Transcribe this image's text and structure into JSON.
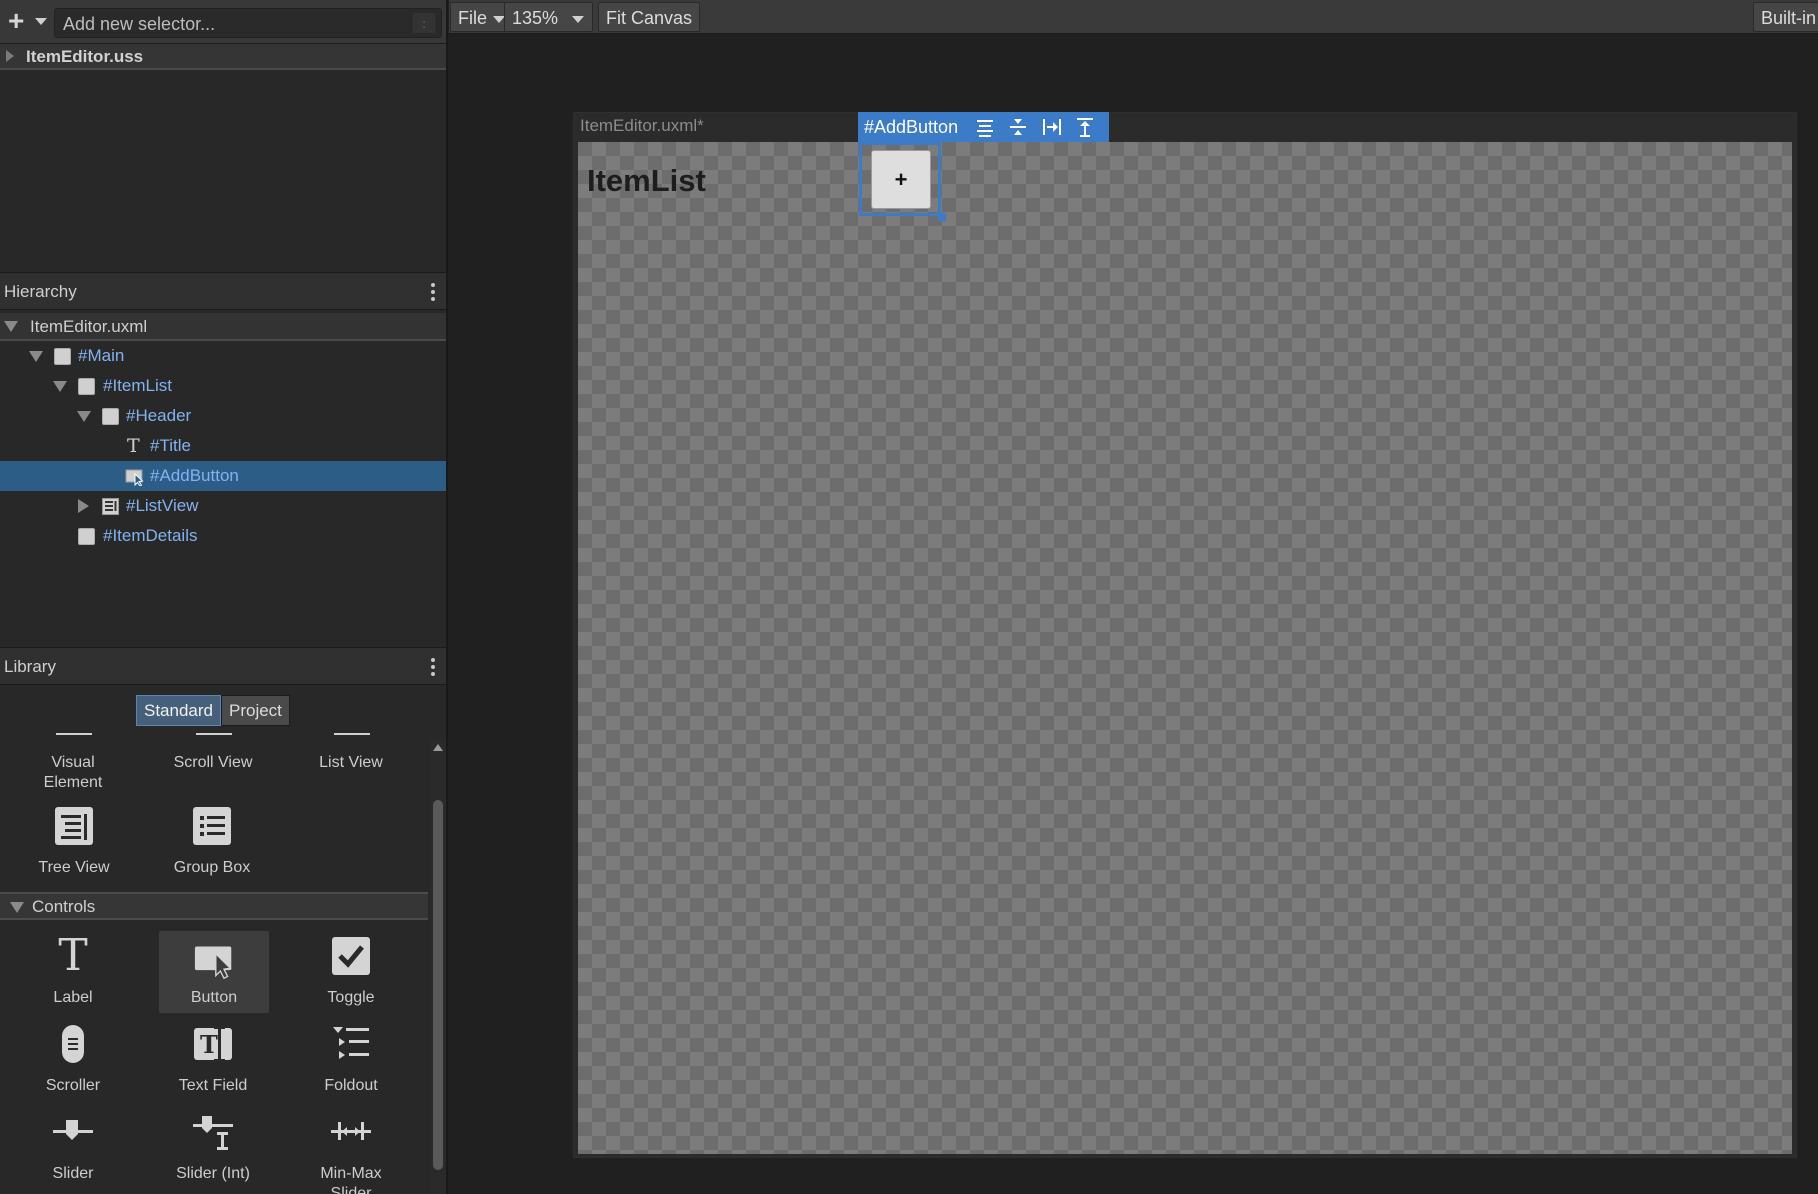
{
  "selectors": {
    "add_label": "+",
    "input_value": "Add new selector...",
    "menu_dots": ":"
  },
  "stylesheets": [
    {
      "label": "ItemEditor.uss"
    }
  ],
  "hierarchy": {
    "title": "Hierarchy",
    "root": "ItemEditor.uxml",
    "items": [
      {
        "label": "#Main",
        "icon": "visual-element-icon",
        "expanded": true
      },
      {
        "label": "#ItemList",
        "icon": "visual-element-icon",
        "expanded": true
      },
      {
        "label": "#Header",
        "icon": "visual-element-icon",
        "expanded": true
      },
      {
        "label": "#Title",
        "icon": "label-icon"
      },
      {
        "label": "#AddButton",
        "icon": "button-icon",
        "selected": true
      },
      {
        "label": "#ListView",
        "icon": "list-view-icon",
        "expanded": false
      },
      {
        "label": "#ItemDetails",
        "icon": "visual-element-icon"
      }
    ]
  },
  "library": {
    "title": "Library",
    "tabs": [
      "Standard",
      "Project"
    ],
    "active_tab": "Standard",
    "containers": [
      {
        "label": "Visual\nElement",
        "icon": "visual-element-icon"
      },
      {
        "label": "Scroll View",
        "icon": "scroll-view-icon"
      },
      {
        "label": "List View",
        "icon": "list-view-icon"
      },
      {
        "label": "Tree View",
        "icon": "tree-view-icon"
      },
      {
        "label": "Group Box",
        "icon": "group-box-icon"
      }
    ],
    "controls_section": "Controls",
    "controls": [
      {
        "label": "Label",
        "icon": "label-icon"
      },
      {
        "label": "Button",
        "icon": "button-icon"
      },
      {
        "label": "Toggle",
        "icon": "toggle-icon"
      },
      {
        "label": "Scroller",
        "icon": "scroller-icon"
      },
      {
        "label": "Text Field",
        "icon": "text-field-icon"
      },
      {
        "label": "Foldout",
        "icon": "foldout-icon"
      },
      {
        "label": "Slider",
        "icon": "slider-icon"
      },
      {
        "label": "Slider (Int)",
        "icon": "slider-int-icon"
      },
      {
        "label": "Min-Max\nSlider",
        "icon": "min-max-slider-icon"
      }
    ]
  },
  "toolbar": {
    "file": "File",
    "zoom": "135%",
    "fit_canvas": "Fit Canvas",
    "theme": "Built-in"
  },
  "viewport": {
    "document_title": "ItemEditor.uxml*",
    "selected_element": "#AddButton",
    "canvas_heading": "ItemList",
    "add_button_label": "+"
  },
  "colors": {
    "selection": "#3c7bc7",
    "hierarchy_link": "#84b1f0",
    "selected_row": "#2c5d87"
  }
}
